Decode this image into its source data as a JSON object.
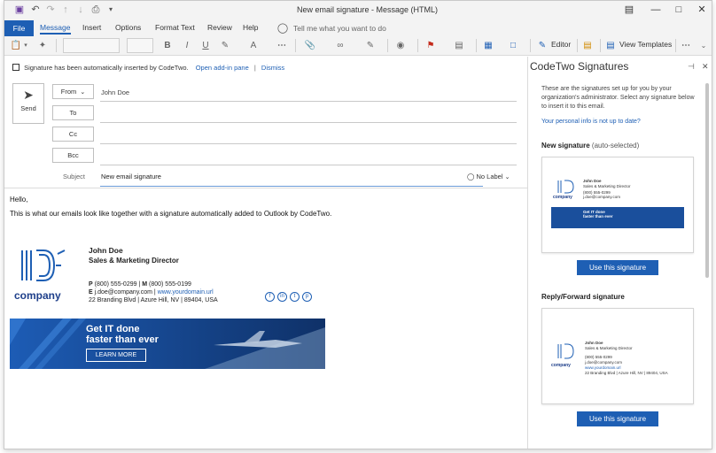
{
  "window": {
    "title": "New email signature  -  Message (HTML)"
  },
  "tabs": [
    "File",
    "Message",
    "Insert",
    "Options",
    "Format Text",
    "Review",
    "Help"
  ],
  "tell_me": "Tell me what you want to do",
  "ribbon": {
    "editor": "Editor",
    "view_templates": "View Templates"
  },
  "infobar": {
    "text": "Signature has been automatically inserted by CodeTwo.",
    "open_link": "Open add-in pane",
    "separator": "|",
    "dismiss": "Dismiss"
  },
  "compose": {
    "send": "Send",
    "from_label": "From",
    "from_value": "John Doe",
    "to_label": "To",
    "cc_label": "Cc",
    "bcc_label": "Bcc",
    "subject_label": "Subject",
    "subject_value": "New email signature",
    "sensitivity": "No Label"
  },
  "body": {
    "greeting": "Hello,",
    "message": "This is what our emails look like together with a signature automatically added to Outlook by CodeTwo."
  },
  "signature": {
    "logo_text": "company",
    "name": "John Doe",
    "title": "Sales & Marketing Director",
    "p_label": "P",
    "phone": "(800) 555-0299",
    "m_label": "M",
    "mobile": "(800) 555-0199",
    "e_label": "E",
    "email": "j.doe@company.com",
    "web": "www.yourdomain.url",
    "address": "22 Branding Blvd | Azure Hill, NV | 89404, USA",
    "social": [
      "f",
      "in",
      "t",
      "p"
    ],
    "banner_line1": "Get IT done",
    "banner_line2": "faster than ever",
    "banner_button": "LEARN MORE"
  },
  "pane": {
    "title": "CodeTwo Signatures",
    "description": "These are the signatures set up for you by your organization's administrator. Select any signature below to insert it to this email.",
    "info_link": "Your personal info is not up to date?",
    "new_sig_label": "New signature",
    "new_sig_note": "(auto-selected)",
    "reply_sig_label": "Reply/Forward signature",
    "use_button": "Use this signature"
  },
  "colors": {
    "accent": "#1e5fb4",
    "banner": "#1a4f9c"
  }
}
